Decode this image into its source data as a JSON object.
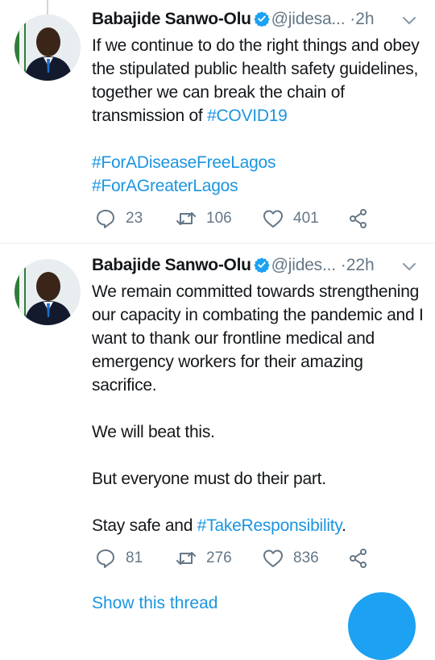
{
  "tweets": [
    {
      "author_name": "Babajide Sanwo-Olu",
      "handle": "@jidesa...",
      "separator": "·",
      "time": "2h",
      "paragraphs": [
        [
          {
            "text": "If we continue to do the right things and obey the stipulated public health safety guidelines, together we can break the chain of transmission of ",
            "type": "text"
          },
          {
            "text": "#COVID19",
            "type": "hashtag"
          }
        ],
        [
          {
            "text": "#ForADiseaseFreeLagos",
            "type": "hashtag"
          }
        ],
        [
          {
            "text": "#ForAGreaterLagos",
            "type": "hashtag"
          }
        ]
      ],
      "replies": "23",
      "retweets": "106",
      "likes": "401"
    },
    {
      "author_name": "Babajide Sanwo-Olu",
      "handle": "@jides...",
      "separator": "·",
      "time": "22h",
      "paragraphs": [
        [
          {
            "text": "We remain committed towards strengthening our capacity in combating the pandemic and I want to thank our frontline medical and emergency workers for their amazing sacrifice.",
            "type": "text"
          }
        ],
        [
          {
            "text": "We will beat this.",
            "type": "text"
          }
        ],
        [
          {
            "text": "But everyone must do their part.",
            "type": "text"
          }
        ],
        [
          {
            "text": "Stay safe and ",
            "type": "text"
          },
          {
            "text": "#TakeResponsibility",
            "type": "hashtag"
          },
          {
            "text": ".",
            "type": "text"
          }
        ]
      ],
      "replies": "81",
      "retweets": "276",
      "likes": "836",
      "show_thread": "Show this thread"
    }
  ],
  "colors": {
    "link": "#1b95e0",
    "muted": "#657786",
    "text": "#14171a",
    "divider": "#e6ecf0",
    "fab": "#1da1f2"
  },
  "icons": [
    "verified-badge-icon",
    "chevron-down-icon",
    "reply-icon",
    "retweet-icon",
    "like-icon",
    "share-icon"
  ]
}
